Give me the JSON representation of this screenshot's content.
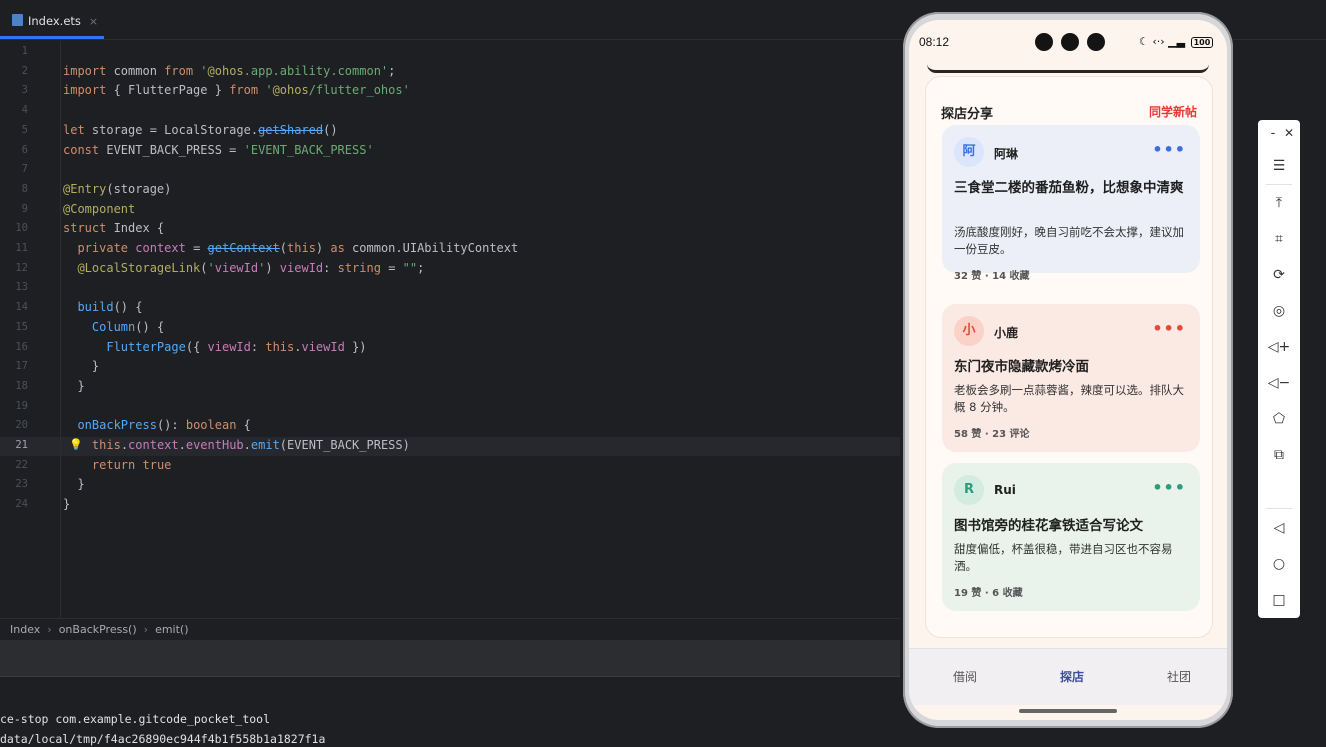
{
  "editor": {
    "tab_label": "Index.ets",
    "tab_close": "×",
    "lines": [
      {
        "num": "1",
        "text": ""
      },
      {
        "num": "2",
        "text": "import common from '@ohos.app.ability.common';"
      },
      {
        "num": "3",
        "text": "import { FlutterPage } from '@ohos/flutter_ohos'"
      },
      {
        "num": "4",
        "text": ""
      },
      {
        "num": "5",
        "text": "let storage = LocalStorage.getShared()"
      },
      {
        "num": "6",
        "text": "const EVENT_BACK_PRESS = 'EVENT_BACK_PRESS'"
      },
      {
        "num": "7",
        "text": ""
      },
      {
        "num": "8",
        "text": "@Entry(storage)"
      },
      {
        "num": "9",
        "text": "@Component"
      },
      {
        "num": "10",
        "text": "struct Index {"
      },
      {
        "num": "11",
        "text": "  private context = getContext(this) as common.UIAbilityContext"
      },
      {
        "num": "12",
        "text": "  @LocalStorageLink('viewId') viewId: string = \"\";"
      },
      {
        "num": "13",
        "text": ""
      },
      {
        "num": "14",
        "text": "  build() {"
      },
      {
        "num": "15",
        "text": "    Column() {"
      },
      {
        "num": "16",
        "text": "      FlutterPage({ viewId: this.viewId })"
      },
      {
        "num": "17",
        "text": "    }"
      },
      {
        "num": "18",
        "text": "  }"
      },
      {
        "num": "19",
        "text": ""
      },
      {
        "num": "20",
        "text": "  onBackPress(): boolean {"
      },
      {
        "num": "21",
        "text": "    this.context.eventHub.emit(EVENT_BACK_PRESS)"
      },
      {
        "num": "22",
        "text": "    return true"
      },
      {
        "num": "23",
        "text": "  }"
      },
      {
        "num": "24",
        "text": "}"
      }
    ],
    "current_line": "21"
  },
  "breadcrumb": [
    "Index",
    "onBackPress()",
    "emit()"
  ],
  "terminal": {
    "lines": [
      "ce-stop com.example.gitcode_pocket_tool",
      "data/local/tmp/f4ac26890ec944f4b1f558b1a1827f1a"
    ]
  },
  "phone": {
    "status": {
      "time": "08:12",
      "battery": "100"
    },
    "feed": {
      "title": "探店分享",
      "action": "同学新帖",
      "cards": [
        {
          "avatar": "阿",
          "author": "阿琳",
          "more": "•••",
          "title": "三食堂二楼的番茄鱼粉，比想象中清爽",
          "body": "汤底酸度刚好，晚自习前吃不会太撑，建议加一份豆皮。",
          "stats": "32 赞 · 14 收藏",
          "bg": "#eceff8",
          "avatar_bg": "#dbe5fb",
          "avatar_color": "#3b6fe0",
          "accent": "#3b6fe0"
        },
        {
          "avatar": "小",
          "author": "小鹿",
          "more": "•••",
          "title": "东门夜市隐藏款烤冷面",
          "body": "老板会多刷一点蒜蓉酱，辣度可以选。排队大概 8 分钟。",
          "stats": "58 赞 · 23 评论",
          "bg": "#fbe9e3",
          "avatar_bg": "#fad2c8",
          "avatar_color": "#e24b3b",
          "accent": "#e24b3b"
        },
        {
          "avatar": "R",
          "author": "Rui",
          "more": "•••",
          "title": "图书馆旁的桂花拿铁适合写论文",
          "body": "甜度偏低，杯盖很稳，带进自习区也不容易洒。",
          "stats": "19 赞 · 6 收藏",
          "bg": "#e9f3ec",
          "avatar_bg": "#d2ece1",
          "avatar_color": "#2a9d7a",
          "accent": "#2a9d7a"
        }
      ]
    },
    "tabs": [
      {
        "label": "借阅",
        "active": false
      },
      {
        "label": "探店",
        "active": true
      },
      {
        "label": "社团",
        "active": false
      }
    ]
  },
  "toolbar": {
    "minimize": "-",
    "close": "✕",
    "icons": [
      "menu-icon",
      "pin-top-icon",
      "crop-icon",
      "rotate-icon",
      "location-icon",
      "volume-up-icon",
      "volume-down-icon",
      "shake-icon",
      "multi-device-icon",
      "back-icon",
      "home-icon",
      "recents-icon"
    ]
  }
}
